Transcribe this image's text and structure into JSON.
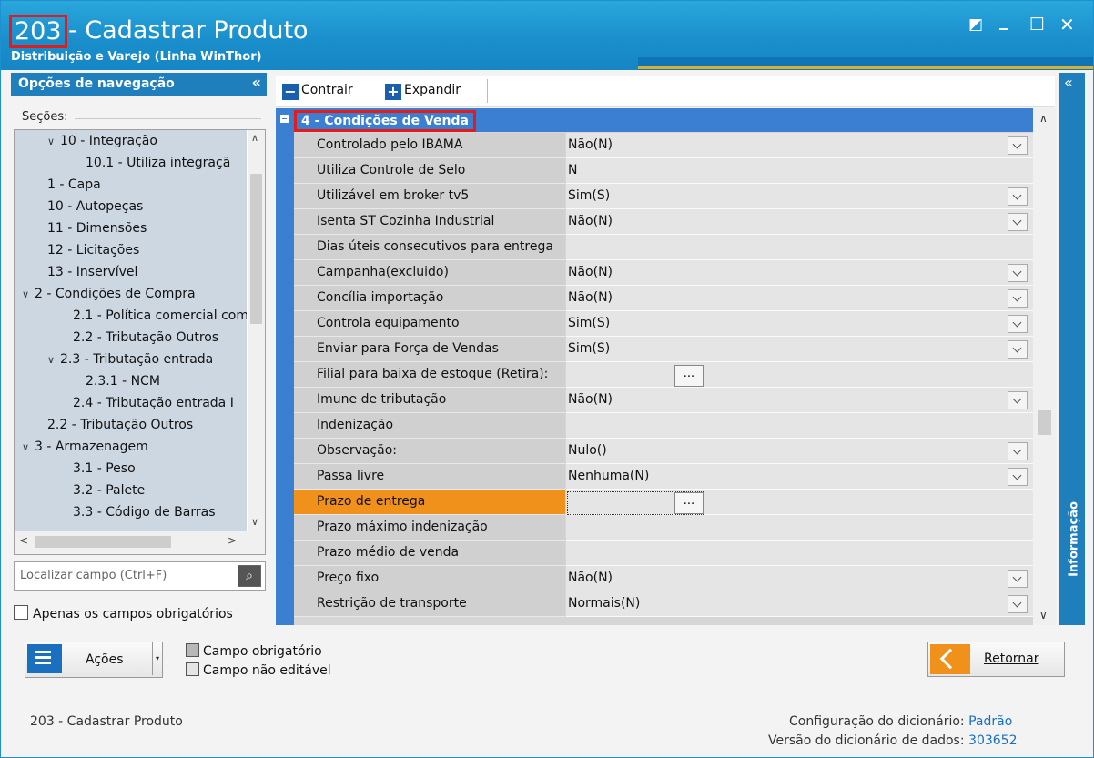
{
  "window": {
    "title_number": "203",
    "title_text": "- Cadastrar  Produto",
    "subtitle": "Distribuição e Varejo (Linha WinThor)",
    "restore_glyph": "◩",
    "minimize_glyph": "_",
    "maximize_glyph": "☐",
    "close_glyph": "✕"
  },
  "nav": {
    "header": "Opções de navegação",
    "collapse_glyph": "«",
    "sections_label": "Seções:",
    "tree": [
      {
        "label": "10 - Integração",
        "expander": "∨",
        "indent": 2,
        "expanded": true
      },
      {
        "label": "10.1 - Utiliza integraçã",
        "expander": "",
        "indent": 4
      },
      {
        "label": "1 - Capa",
        "expander": "",
        "indent": 1
      },
      {
        "label": "10 - Autopeças",
        "expander": "",
        "indent": 1
      },
      {
        "label": "11 - Dimensões",
        "expander": "",
        "indent": 1
      },
      {
        "label": "12 - Licitações",
        "expander": "",
        "indent": 1
      },
      {
        "label": "13 - Inservível",
        "expander": "",
        "indent": 1
      },
      {
        "label": "2 - Condições de Compra",
        "expander": "∨",
        "indent": 0,
        "expanded": true
      },
      {
        "label": "2.1 - Política comercial com",
        "expander": "",
        "indent": 3
      },
      {
        "label": "2.2 - Tributação Outros",
        "expander": "",
        "indent": 3
      },
      {
        "label": "2.3 - Tributação entrada",
        "expander": "∨",
        "indent": 2,
        "expanded": true
      },
      {
        "label": "2.3.1 - NCM",
        "expander": "",
        "indent": 4
      },
      {
        "label": "2.4 - Tributação entrada I",
        "expander": "",
        "indent": 3
      },
      {
        "label": "2.2 - Tributação Outros",
        "expander": "",
        "indent": 1
      },
      {
        "label": "3 - Armazenagem",
        "expander": "∨",
        "indent": 0,
        "expanded": true
      },
      {
        "label": "3.1 - Peso",
        "expander": "",
        "indent": 3
      },
      {
        "label": "3.2 - Palete",
        "expander": "",
        "indent": 3
      },
      {
        "label": "3.3 - Código de Barras",
        "expander": "",
        "indent": 3
      }
    ],
    "search_placeholder": "Localizar campo (Ctrl+F)",
    "search_glyph": "⌕",
    "only_required_label": "Apenas os campos obrigatórios"
  },
  "toolbar": {
    "collapse_label": "Contrair",
    "collapse_glyph": "−",
    "expand_label": "Expandir",
    "expand_glyph": "+"
  },
  "grid": {
    "section_title": "4 - Condições de Venda",
    "rows": [
      {
        "name": "Controlado pelo IBAMA",
        "value": "Não(N)",
        "editor": "dropdown"
      },
      {
        "name": "Utiliza Controle de Selo",
        "value": "N",
        "editor": "none"
      },
      {
        "name": "Utilizável em broker tv5",
        "value": "Sim(S)",
        "editor": "dropdown"
      },
      {
        "name": "Isenta ST Cozinha Industrial",
        "value": "Não(N)",
        "editor": "dropdown"
      },
      {
        "name": "Dias úteis consecutivos para entrega",
        "value": "",
        "editor": "none"
      },
      {
        "name": "Campanha(excluido)",
        "value": "Não(N)",
        "editor": "dropdown"
      },
      {
        "name": "Concília importação",
        "value": "Não(N)",
        "editor": "dropdown"
      },
      {
        "name": "Controla equipamento",
        "value": "Sim(S)",
        "editor": "dropdown"
      },
      {
        "name": "Enviar para Força de Vendas",
        "value": "Sim(S)",
        "editor": "dropdown"
      },
      {
        "name": "Filial para baixa de estoque (Retira):",
        "value": "",
        "editor": "ellipsis"
      },
      {
        "name": "Imune de tributação",
        "value": "Não(N)",
        "editor": "dropdown"
      },
      {
        "name": "Indenização",
        "value": "",
        "editor": "none"
      },
      {
        "name": "Observação:",
        "value": "Nulo()",
        "editor": "dropdown"
      },
      {
        "name": "Passa livre",
        "value": "Nenhuma(N)",
        "editor": "dropdown"
      },
      {
        "name": "Prazo de entrega",
        "value": "",
        "editor": "ellipsis",
        "selected": true
      },
      {
        "name": "Prazo máximo indenização",
        "value": "",
        "editor": "none"
      },
      {
        "name": "Prazo médio de venda",
        "value": "",
        "editor": "none"
      },
      {
        "name": "Preço fixo",
        "value": "Não(N)",
        "editor": "dropdown"
      },
      {
        "name": "Restrição de transporte",
        "value": "Normais(N)",
        "editor": "dropdown"
      }
    ],
    "ellipsis_label": "..."
  },
  "info_panel": {
    "label": "Informação",
    "collapse_glyph": "«"
  },
  "actions": {
    "acoes_label": "Ações",
    "acoes_arrow": "▾",
    "legend_required": "Campo obrigatório",
    "legend_readonly": "Campo não editável",
    "return_label": "Retornar"
  },
  "footer": {
    "screen_name": "203 - Cadastrar  Produto",
    "dict_config_label": "Configuração do dicionário:",
    "dict_config_value": "Padrão",
    "dict_version_label": "Versão do dicionário de dados:",
    "dict_version_value": "303652"
  },
  "colors": {
    "title_bar": "#1a8fcc",
    "nav_header": "#1f7fbd",
    "grid_section": "#3a7fd2",
    "selected_row": "#f0911c",
    "highlight_border": "#e21b1b"
  }
}
